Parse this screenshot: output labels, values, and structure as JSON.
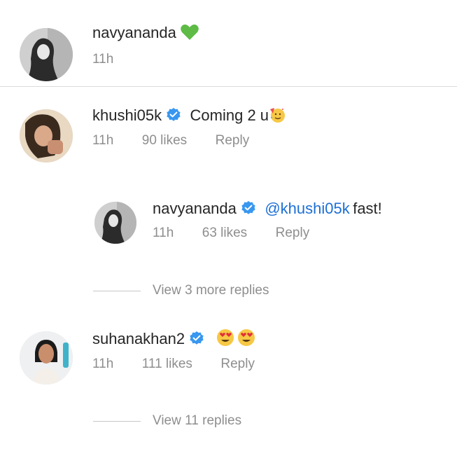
{
  "comments": [
    {
      "username": "navyananda",
      "verified": false,
      "text": "",
      "emoji": "green-heart",
      "time": "11h",
      "likes": "",
      "reply": ""
    },
    {
      "username": "khushi05k",
      "verified": true,
      "text": "Coming 2 u",
      "emoji": "partying-face",
      "time": "11h",
      "likes": "90 likes",
      "reply": "Reply",
      "replies": [
        {
          "username": "navyananda",
          "verified": true,
          "mention": "@khushi05k",
          "text": "fast!",
          "time": "11h",
          "likes": "63 likes",
          "reply": "Reply"
        }
      ],
      "view_more": "View 3 more replies"
    },
    {
      "username": "suhanakhan2",
      "verified": true,
      "text": "",
      "emoji": "heart-eyes",
      "time": "11h",
      "likes": "111 likes",
      "reply": "Reply",
      "view_more": "View 11 replies"
    }
  ],
  "colors": {
    "verified_blue": "#3897f0",
    "mention_blue": "#1d6fd6",
    "muted_text": "#8e8e8e",
    "green_heart": "#5dbb46"
  }
}
